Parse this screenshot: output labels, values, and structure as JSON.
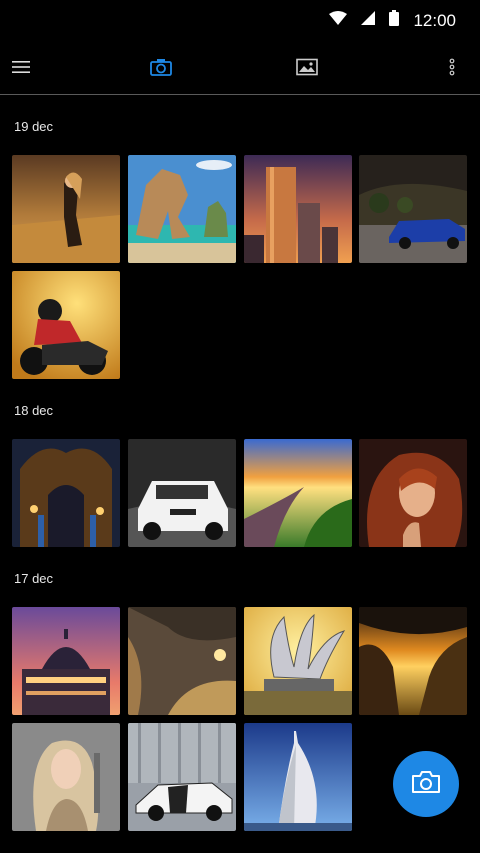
{
  "status_bar": {
    "time": "12:00"
  },
  "app_bar": {
    "icons": [
      "menu-icon",
      "camera-tab-icon",
      "gallery-tab-icon",
      "more-vert-icon"
    ],
    "active_tab": "camera",
    "accent": "#1e88e5"
  },
  "sections": [
    {
      "date": "19 dec",
      "photos": [
        "girl in wheat field",
        "rock arch by sea",
        "skyscrapers at sunset",
        "blue car on road",
        "quad bike rider"
      ]
    },
    {
      "date": "18 dec",
      "photos": [
        "ornate night street",
        "white sports car",
        "road at sunset",
        "red-haired woman"
      ]
    },
    {
      "date": "17 dec",
      "photos": [
        "domed basilica at dusk",
        "rock canyon",
        "modern sculpture",
        "valley at sunset",
        "blonde woman",
        "white supercar",
        "sail-shaped tower"
      ]
    }
  ],
  "fab": {
    "icon": "camera-icon",
    "color": "#1e88e5"
  }
}
